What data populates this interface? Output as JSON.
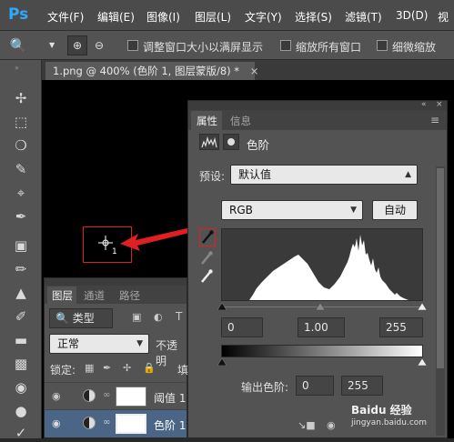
{
  "app": {
    "logo": "Ps"
  },
  "menubar": {
    "items": [
      "文件(F)",
      "编辑(E)",
      "图像(I)",
      "图层(L)",
      "文字(Y)",
      "选择(S)",
      "滤镜(T)",
      "3D(D)",
      "视"
    ]
  },
  "options_bar": {
    "checkbox1_label": "调整窗口大小以满屏显示",
    "checkbox2_label": "缩放所有窗口",
    "checkbox3_label": "细微缩放"
  },
  "document": {
    "tab_title": "1.png @ 400% (色阶 1, 图层蒙版/8) *",
    "close": "×"
  },
  "canvas": {
    "cursor_label": "1"
  },
  "properties_panel": {
    "tabs": [
      "属性",
      "信息"
    ],
    "active_tab": "属性",
    "title": "色阶",
    "preset_label": "预设:",
    "preset_value": "默认值",
    "channel_value": "RGB",
    "auto_button": "自动",
    "input_levels": {
      "black": "0",
      "gamma": "1.00",
      "white": "255"
    },
    "output_label": "输出色阶:",
    "output_levels": {
      "black": "0",
      "white": "255"
    },
    "collapse_icon": "«",
    "menu_icon": "≡"
  },
  "layers_panel": {
    "tabs": [
      "图层",
      "通道",
      "路径"
    ],
    "active_tab": "图层",
    "filter_label": "类型",
    "blend_mode": "正常",
    "opacity_label": "不透明",
    "lock_label": "锁定:",
    "fill_label": "填",
    "layers": [
      {
        "name": "阈值 1"
      },
      {
        "name": "色阶 1"
      }
    ]
  },
  "colors": {
    "menubar": "#4b4b4b",
    "panel": "#535353",
    "canvas": "#000000",
    "annotation": "#e02020",
    "accent": "#31a8ff"
  },
  "watermark": {
    "text": "Baidu 经验",
    "url": "jingyan.baidu.com"
  }
}
